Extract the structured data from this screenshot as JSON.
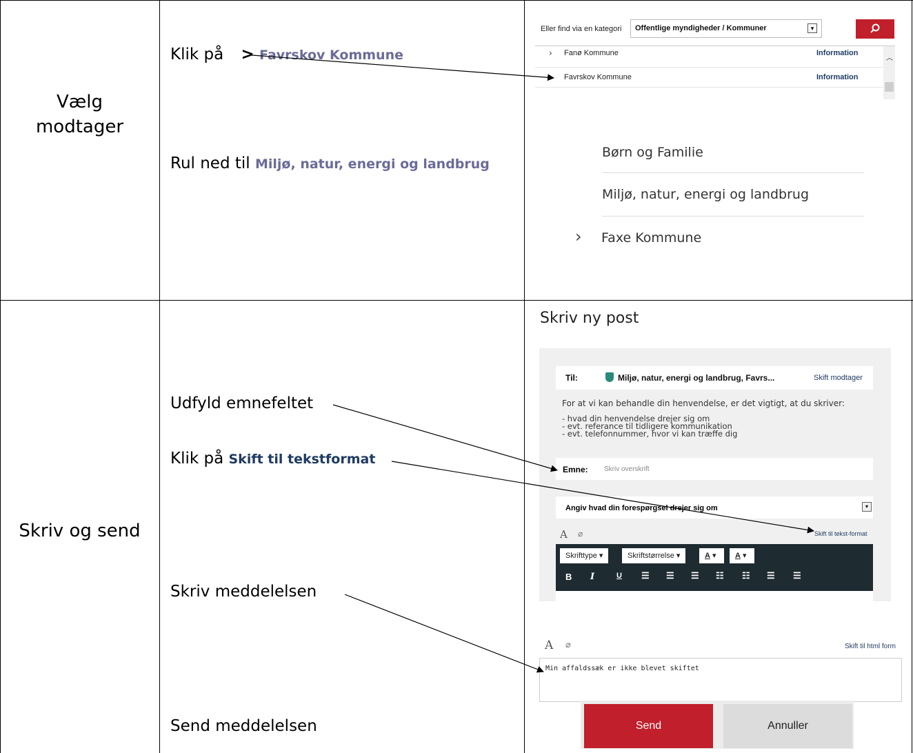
{
  "rows": [
    {
      "step": "Vælg\nmodtager"
    },
    {
      "step": "Skriv og send"
    }
  ],
  "row1": {
    "instr1_prefix": "Klik på",
    "instr1_arrow": ">",
    "instr1_link": "Favrskov Kommune",
    "instr2_prefix": "Rul ned til",
    "instr2_link": "Miljø, natur, energi og landbrug",
    "category": {
      "label": "Eller find via en kategori",
      "selected": "Offentlige myndigheder / Kommuner",
      "items": [
        {
          "name": "Fanø Kommune",
          "action": "Information"
        },
        {
          "name": "Favrskov Kommune",
          "action": "Information"
        }
      ]
    },
    "list2": {
      "sub1": "Børn og Familie",
      "sub2": "Miljø, natur, energi og landbrug",
      "next": "Faxe Kommune"
    }
  },
  "row2": {
    "instr_subject": "Udfyld emnefeltet",
    "instr_click_prefix": "Klik på",
    "instr_click_link": "Skift til tekstformat",
    "instr_write": "Skriv meddelelsen",
    "instr_send": "Send meddelelsen",
    "form": {
      "heading": "Skriv ny post",
      "to_label": "Til:",
      "recipient": "Miljø, natur, energi og landbrug, Favrs...",
      "change_recipient": "Skift modtager",
      "intro": "For at vi kan behandle din henvendelse, er det vigtigt, at du skriver:",
      "bullets": [
        "- hvad din henvendelse drejer sig om",
        "- evt. referance til tidligere kommunikation",
        "- evt. telefonnummer, hvor vi kan træffe dig"
      ],
      "subject_label": "Emne:",
      "subject_placeholder": "Skriv overskrift",
      "topic_select": "Angiv hvad din forespørgsel drejer sig om",
      "switch_text": "Skift til tekst-format",
      "font_type": "Skrifttype",
      "font_size": "Skriftstørrelse",
      "color_a": "A",
      "bold": "B",
      "italic": "I",
      "underline": "U"
    },
    "text_editor": {
      "switch_html": "Skift til html form",
      "message": "Min affaldssæk er ikke blevet skiftet"
    },
    "buttons": {
      "send": "Send",
      "cancel": "Annuller"
    }
  },
  "colors": {
    "accent_red": "#c01f2b",
    "toolbar_dark": "#1e2b30",
    "link_blue": "#1f3b63",
    "highlight_purple": "#6b6b99"
  }
}
